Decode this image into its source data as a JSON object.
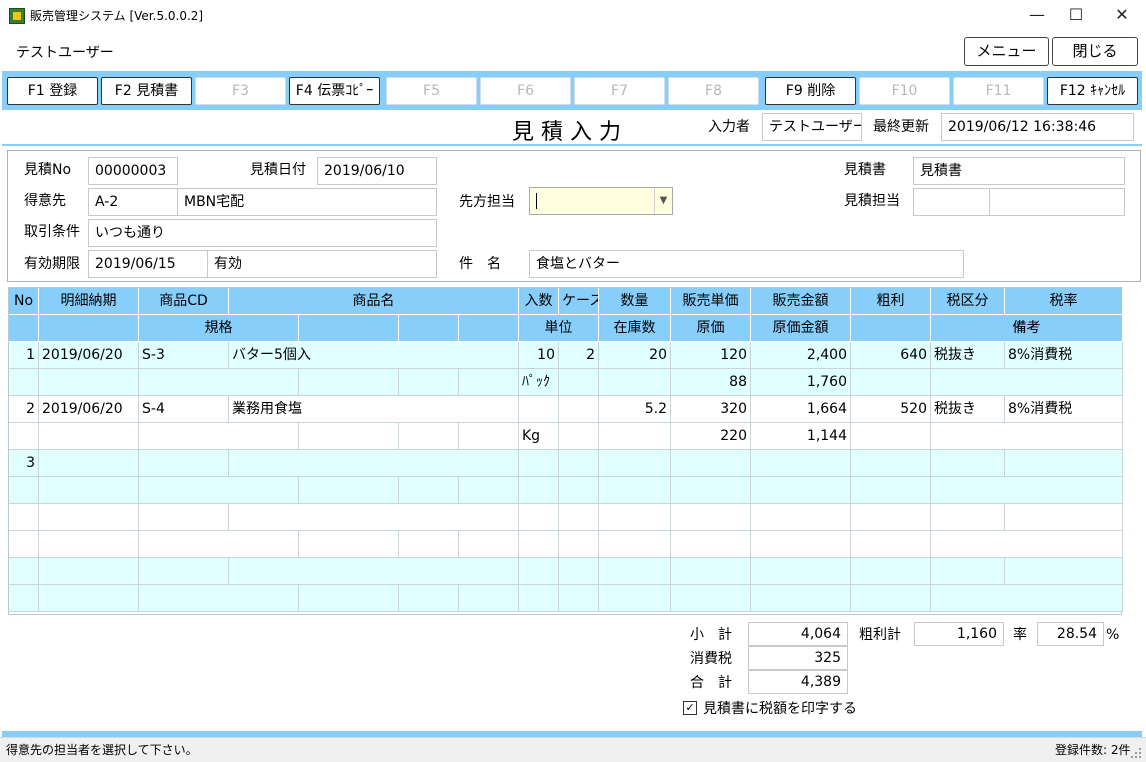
{
  "window": {
    "title": "販売管理システム [Ver.5.0.0.2]",
    "min_glyph": "—",
    "max_glyph": "☐",
    "close_glyph": "✕"
  },
  "user": "テストユーザー",
  "top_buttons": {
    "menu": "メニュー",
    "close": "閉じる"
  },
  "fkeys": [
    {
      "label": "F1 登録",
      "enabled": true
    },
    {
      "label": "F2 見積書",
      "enabled": true
    },
    {
      "label": "F3",
      "enabled": false
    },
    {
      "label": "F4 伝票ｺﾋﾟｰ",
      "enabled": true
    },
    {
      "label": "F5",
      "enabled": false
    },
    {
      "label": "F6",
      "enabled": false
    },
    {
      "label": "F7",
      "enabled": false
    },
    {
      "label": "F8",
      "enabled": false
    },
    {
      "label": "F9 削除",
      "enabled": true
    },
    {
      "label": "F10",
      "enabled": false
    },
    {
      "label": "F11",
      "enabled": false
    },
    {
      "label": "F12 ｷｬﾝｾﾙ",
      "enabled": true
    }
  ],
  "header": {
    "screen_title": "見積入力",
    "input_by_label": "入力者",
    "input_by": "テストユーザー",
    "last_updated_label": "最終更新",
    "last_updated": "2019/06/12 16:38:46"
  },
  "form": {
    "quote_no_label": "見積No",
    "quote_no": "00000003",
    "quote_date_label": "見積日付",
    "quote_date": "2019/06/10",
    "customer_label": "得意先",
    "customer_code": "A-2",
    "customer_name": "MBN宅配",
    "contact_label": "先方担当",
    "contact_value": "",
    "terms_label": "取引条件",
    "terms": "いつも通り",
    "expiry_label": "有効期限",
    "expiry_date": "2019/06/15",
    "expiry_status": "有効",
    "subject_label": "件　名",
    "subject": "食塩とバター",
    "doc_label": "見積書",
    "doc_value": "見積書",
    "staff_label": "見積担当",
    "staff_code": "",
    "staff_name": ""
  },
  "grid": {
    "header1": [
      "No",
      "明細納期",
      "商品CD",
      "商品名",
      "入数",
      "ケース",
      "数量",
      "販売単価",
      "販売金額",
      "粗利",
      "税区分",
      "税率"
    ],
    "header2": [
      "規格",
      "単位",
      "在庫数",
      "原価",
      "原価金額",
      "備考"
    ],
    "rows": [
      {
        "no": "1",
        "date": "2019/06/20",
        "code": "S-3",
        "name": "バター5個入",
        "irisu": "10",
        "case": "2",
        "qty": "20",
        "price": "120",
        "amount": "2,400",
        "profit": "640",
        "tax_class": "税抜き",
        "tax_rate": "8%消費税",
        "unit": "ﾊﾟｯｸ",
        "cost": "88",
        "cost_amount": "1,760"
      },
      {
        "no": "2",
        "date": "2019/06/20",
        "code": "S-4",
        "name": "業務用食塩",
        "irisu": "",
        "case": "",
        "qty": "5.2",
        "price": "320",
        "amount": "1,664",
        "profit": "520",
        "tax_class": "税抜き",
        "tax_rate": "8%消費税",
        "unit": "Kg",
        "cost": "220",
        "cost_amount": "1,144"
      },
      {
        "no": "3",
        "date": "",
        "code": "",
        "name": "",
        "irisu": "",
        "case": "",
        "qty": "",
        "price": "",
        "amount": "",
        "profit": "",
        "tax_class": "",
        "tax_rate": "",
        "unit": "",
        "cost": "",
        "cost_amount": ""
      }
    ]
  },
  "totals": {
    "subtotal_label": "小　計",
    "subtotal": "4,064",
    "tax_label": "消費税",
    "tax": "325",
    "total_label": "合　計",
    "total": "4,389",
    "gross_label": "粗利計",
    "gross": "1,160",
    "rate_label": "率",
    "rate": "28.54",
    "rate_unit": "%",
    "print_tax_label": "見積書に税額を印字する",
    "print_tax_checked": true
  },
  "status": {
    "message": "得意先の担当者を選択して下さい。",
    "count": "登録件数: 2件"
  },
  "colors": {
    "accent": "#87cefa",
    "row_alt": "#e0ffff",
    "focus_field": "#ffffe0"
  }
}
